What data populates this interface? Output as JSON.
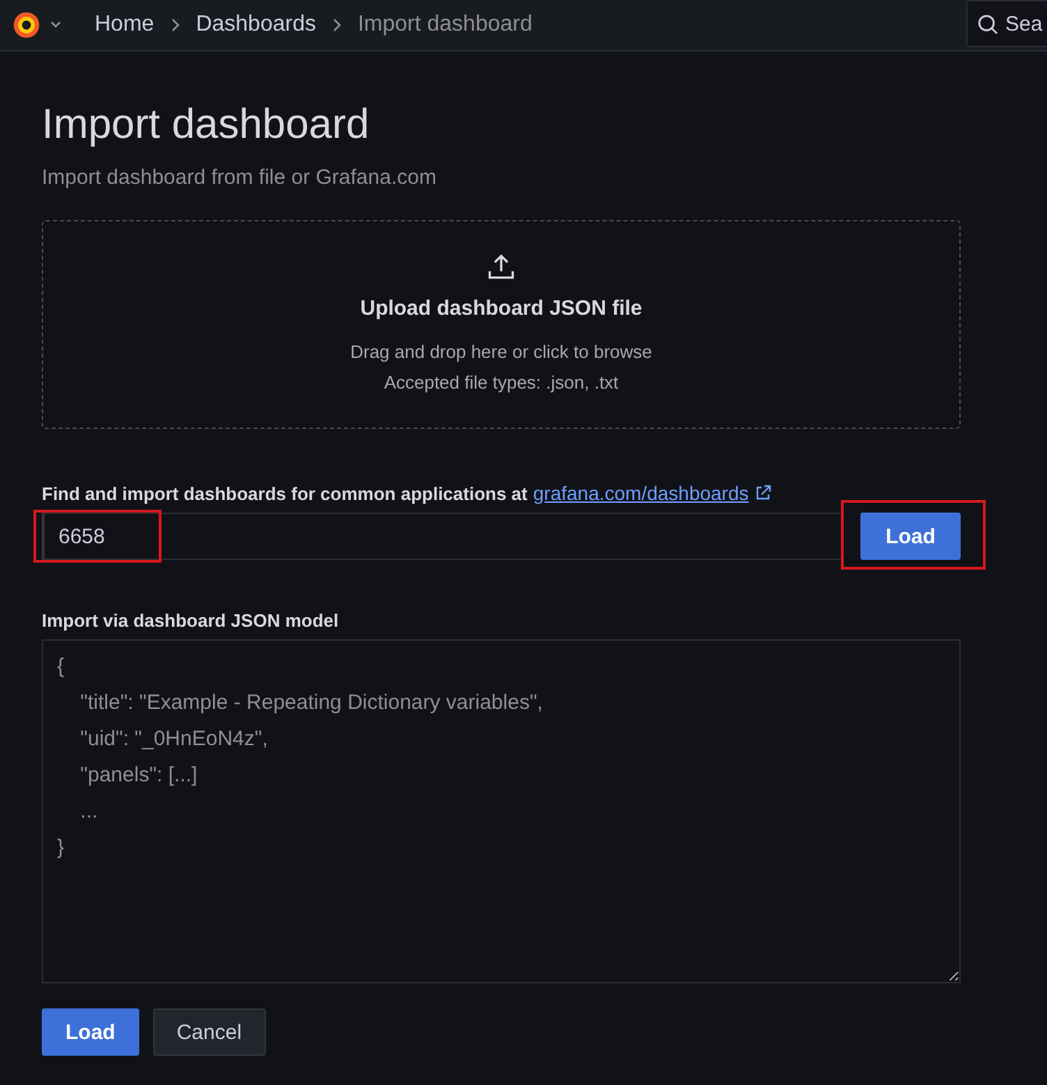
{
  "topbar": {
    "breadcrumbs": [
      {
        "label": "Home",
        "current": false
      },
      {
        "label": "Dashboards",
        "current": false
      },
      {
        "label": "Import dashboard",
        "current": true
      }
    ],
    "search": {
      "placeholder": "Sea"
    }
  },
  "page": {
    "title": "Import dashboard",
    "subtitle": "Import dashboard from file or Grafana.com"
  },
  "upload": {
    "title": "Upload dashboard JSON file",
    "hint": "Drag and drop here or click to browse",
    "types": "Accepted file types: .json, .txt"
  },
  "grafana_com": {
    "label": "Find and import dashboards for common applications at",
    "link": "grafana.com/dashboards",
    "value": "6658",
    "value_highlighted": true,
    "button": "Load",
    "button_highlighted": true
  },
  "json_model": {
    "label": "Import via dashboard JSON model",
    "placeholder": "{\n    \"title\": \"Example - Repeating Dictionary variables\",\n    \"uid\": \"_0HnEoN4z\",\n    \"panels\": [...]\n    ...\n}"
  },
  "buttons": [
    {
      "label": "Load",
      "kind": "primary"
    },
    {
      "label": "Cancel",
      "kind": "secondary"
    }
  ]
}
